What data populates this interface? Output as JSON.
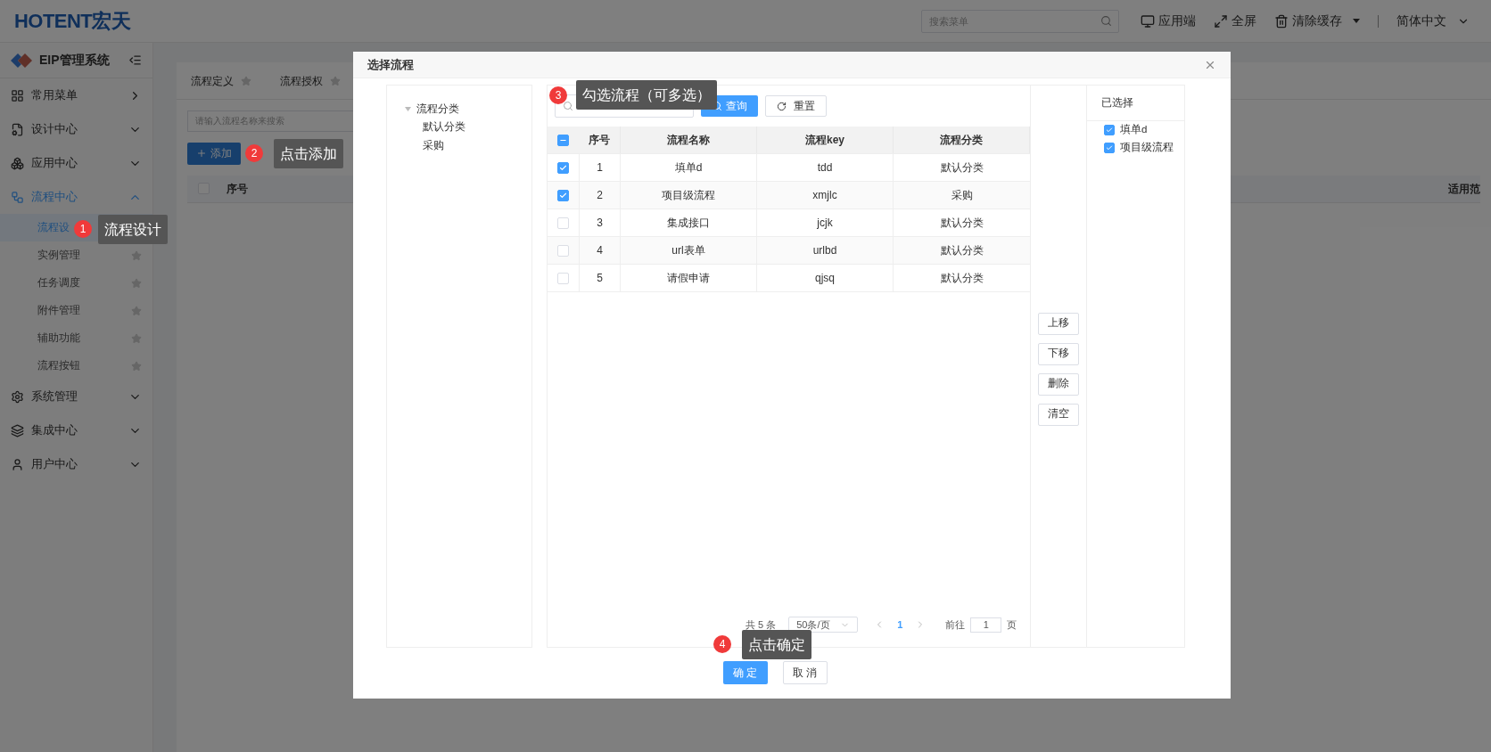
{
  "header": {
    "logo": "HOTENT宏天",
    "search_placeholder": "搜索菜单",
    "actions": [
      {
        "label": "应用端",
        "dropdown": false
      },
      {
        "label": "全屏",
        "dropdown": false
      },
      {
        "label": "清除缓存",
        "dropdown": true
      }
    ],
    "language": "简体中文"
  },
  "sidebar": {
    "title": "EIP管理系统",
    "items": [
      {
        "label": "常用菜单",
        "expanded": false,
        "selected": false
      },
      {
        "label": "设计中心",
        "expanded": false,
        "selected": false
      },
      {
        "label": "应用中心",
        "expanded": false,
        "selected": false
      },
      {
        "label": "流程中心",
        "expanded": true,
        "selected": true,
        "children": [
          {
            "label": "流程设",
            "selected": true
          },
          {
            "label": "实例管理",
            "selected": false
          },
          {
            "label": "任务调度",
            "selected": false
          },
          {
            "label": "附件管理",
            "selected": false
          },
          {
            "label": "辅助功能",
            "selected": false
          },
          {
            "label": "流程按钮",
            "selected": false
          }
        ]
      },
      {
        "label": "系统管理",
        "expanded": false,
        "selected": false
      },
      {
        "label": "集成中心",
        "expanded": false,
        "selected": false
      },
      {
        "label": "用户中心",
        "expanded": false,
        "selected": false
      }
    ]
  },
  "main": {
    "tabs": [
      "流程定义",
      "流程授权"
    ],
    "select_all_checked": false,
    "search_placeholder": "请输入流程名称来搜索",
    "add_button": "添加",
    "columns": [
      "序号",
      "适用范"
    ]
  },
  "dialog": {
    "title": "选择流程",
    "tree": {
      "label": "流程分类",
      "expanded": true,
      "children": [
        {
          "label": "默认分类"
        },
        {
          "label": "采购"
        }
      ]
    },
    "query_button": "查询",
    "reset_button": "重置",
    "header_checkbox": {
      "indeterminate": true
    },
    "columns": [
      "序号",
      "流程名称",
      "流程key",
      "流程分类"
    ],
    "rows": [
      {
        "index": "1",
        "name": "填单d",
        "key": "tdd",
        "category": "默认分类",
        "checked": true
      },
      {
        "index": "2",
        "name": "项目级流程",
        "key": "xmjlc",
        "category": "采购",
        "checked": true
      },
      {
        "index": "3",
        "name": "集成接口",
        "key": "jcjk",
        "category": "默认分类",
        "checked": false
      },
      {
        "index": "4",
        "name": "url表单",
        "key": "urlbd",
        "category": "默认分类",
        "checked": false
      },
      {
        "index": "5",
        "name": "请假申请",
        "key": "qjsq",
        "category": "默认分类",
        "checked": false
      }
    ],
    "pagination": {
      "total": "共 5 条",
      "page_size": "50条/页",
      "current": "1",
      "goto_label": "前往",
      "goto_value": "1",
      "goto_suffix": "页"
    },
    "side_buttons": [
      "上移",
      "下移",
      "删除",
      "清空"
    ],
    "selected_title": "已选择",
    "selected": [
      {
        "label": "填单d",
        "checked": true
      },
      {
        "label": "项目级流程",
        "checked": true
      }
    ],
    "confirm": "确 定",
    "cancel": "取 消"
  },
  "callouts": [
    {
      "number": "1",
      "text": "流程设计"
    },
    {
      "number": "2",
      "text": "点击添加"
    },
    {
      "number": "3",
      "text": "勾选流程（可多选）"
    },
    {
      "number": "4",
      "text": "点击确定"
    }
  ]
}
